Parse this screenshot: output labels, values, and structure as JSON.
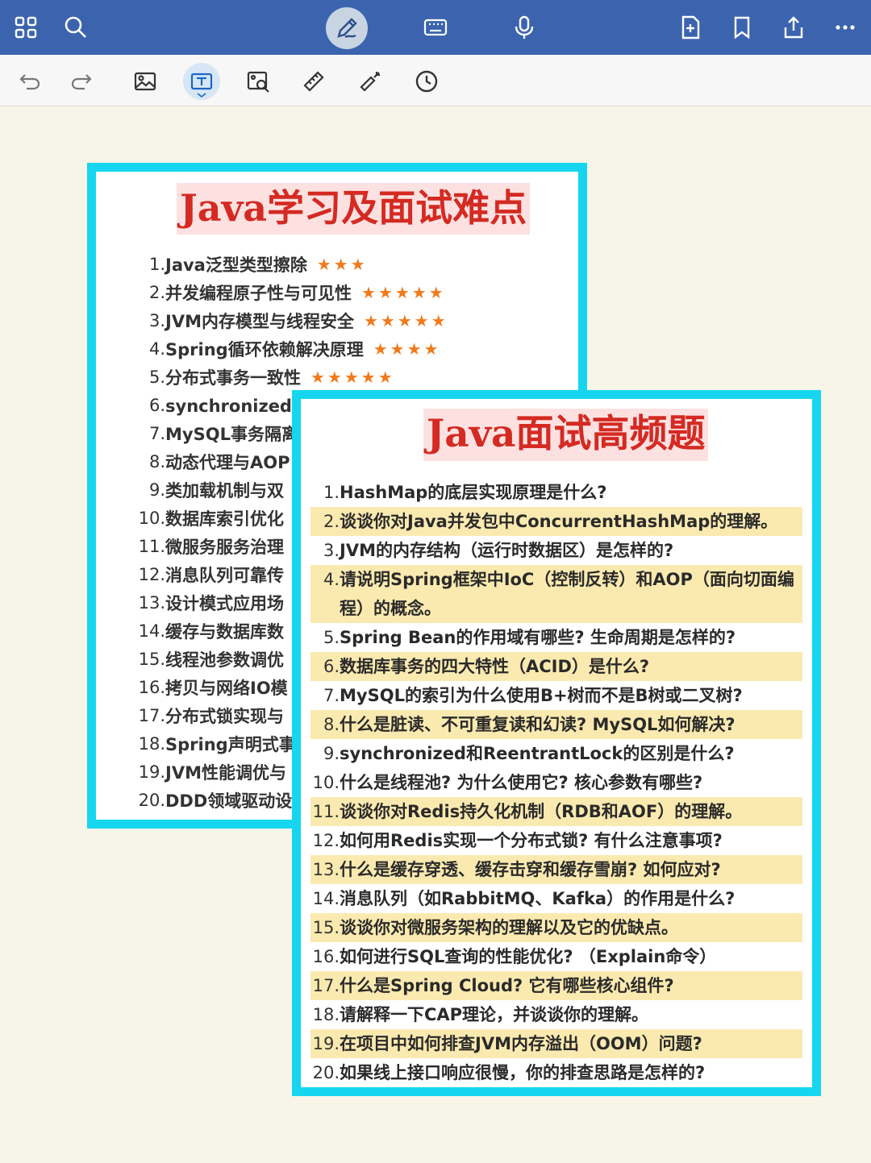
{
  "topbar": {
    "icons": [
      "grid-icon",
      "search-icon",
      "pen-icon",
      "keyboard-icon",
      "microphone-icon",
      "add-page-icon",
      "bookmark-icon",
      "share-icon",
      "more-icon"
    ],
    "color": "#3c64ae"
  },
  "toolbar": {
    "icons": [
      "undo-icon",
      "redo-icon",
      "image-icon",
      "text-box-icon",
      "image-search-icon",
      "ruler-icon",
      "laser-pointer-icon",
      "timer-icon"
    ],
    "active": "text-box-icon"
  },
  "left_card": {
    "title": "Java学习及面试难点",
    "items": [
      {
        "num": "1.",
        "text": "Java泛型类型擦除",
        "stars": "★★★"
      },
      {
        "num": "2.",
        "text": "并发编程原子性与可见性",
        "stars": "★★★★★"
      },
      {
        "num": "3.",
        "text": "JVM内存模型与线程安全",
        "stars": "★★★★★"
      },
      {
        "num": "4.",
        "text": "Spring循环依赖解决原理",
        "stars": "★★★★"
      },
      {
        "num": "5.",
        "text": "分布式事务一致性",
        "stars": "★★★★★"
      },
      {
        "num": "6.",
        "text": "synchronized的",
        "stars": ""
      },
      {
        "num": "7.",
        "text": "MySQL事务隔离",
        "stars": ""
      },
      {
        "num": "8.",
        "text": "动态代理与AOP",
        "stars": ""
      },
      {
        "num": "9.",
        "text": "类加载机制与双",
        "stars": ""
      },
      {
        "num": "10.",
        "text": "数据库索引优化",
        "stars": ""
      },
      {
        "num": "11.",
        "text": "微服务服务治理",
        "stars": ""
      },
      {
        "num": "12.",
        "text": "消息队列可靠传",
        "stars": ""
      },
      {
        "num": "13.",
        "text": "设计模式应用场",
        "stars": ""
      },
      {
        "num": "14.",
        "text": "缓存与数据库数",
        "stars": ""
      },
      {
        "num": "15.",
        "text": "线程池参数调优",
        "stars": ""
      },
      {
        "num": "16.",
        "text": "拷贝与网络IO模",
        "stars": ""
      },
      {
        "num": "17.",
        "text": "分布式锁实现与",
        "stars": ""
      },
      {
        "num": "18.",
        "text": "Spring声明式事",
        "stars": ""
      },
      {
        "num": "19.",
        "text": "JVM性能调优与",
        "stars": ""
      },
      {
        "num": "20.",
        "text": "DDD领域驱动设",
        "stars": ""
      }
    ]
  },
  "right_card": {
    "title": "Java面试高频题",
    "items": [
      {
        "num": "1.",
        "text": "HashMap的底层实现原理是什么?",
        "highlight": false
      },
      {
        "num": "2.",
        "text": "谈谈你对Java并发包中ConcurrentHashMap的理解。",
        "highlight": true
      },
      {
        "num": "3.",
        "text": "JVM的内存结构（运行时数据区）是怎样的?",
        "highlight": false
      },
      {
        "num": "4.",
        "text": "请说明Spring框架中IoC（控制反转）和AOP（面向切面编程）的概念。",
        "highlight": true
      },
      {
        "num": "5.",
        "text": "Spring Bean的作用域有哪些? 生命周期是怎样的?",
        "highlight": false
      },
      {
        "num": "6.",
        "text": "数据库事务的四大特性（ACID）是什么?",
        "highlight": true
      },
      {
        "num": "7.",
        "text": "MySQL的索引为什么使用B+树而不是B树或二叉树?",
        "highlight": false
      },
      {
        "num": "8.",
        "text": "什么是脏读、不可重复读和幻读? MySQL如何解决?",
        "highlight": true
      },
      {
        "num": "9.",
        "text": "synchronized和ReentrantLock的区别是什么?",
        "highlight": false
      },
      {
        "num": "10.",
        "text": "什么是线程池? 为什么使用它? 核心参数有哪些?",
        "highlight": false
      },
      {
        "num": "11.",
        "text": "谈谈你对Redis持久化机制（RDB和AOF）的理解。",
        "highlight": true
      },
      {
        "num": "12.",
        "text": "如何用Redis实现一个分布式锁? 有什么注意事项?",
        "highlight": false
      },
      {
        "num": "13.",
        "text": "什么是缓存穿透、缓存击穿和缓存雪崩? 如何应对?",
        "highlight": true
      },
      {
        "num": "14.",
        "text": "消息队列（如RabbitMQ、Kafka）的作用是什么?",
        "highlight": false
      },
      {
        "num": "15.",
        "text": "谈谈你对微服务架构的理解以及它的优缺点。",
        "highlight": true
      },
      {
        "num": "16.",
        "text": "如何进行SQL查询的性能优化? （Explain命令）",
        "highlight": false
      },
      {
        "num": "17.",
        "text": "什么是Spring Cloud? 它有哪些核心组件?",
        "highlight": true
      },
      {
        "num": "18.",
        "text": "请解释一下CAP理论，并谈谈你的理解。",
        "highlight": false
      },
      {
        "num": "19.",
        "text": "在项目中如何排查JVM内存溢出（OOM）问题?",
        "highlight": true
      },
      {
        "num": "20.",
        "text": "如果线上接口响应很慢，你的排查思路是怎样的?",
        "highlight": false
      }
    ]
  }
}
